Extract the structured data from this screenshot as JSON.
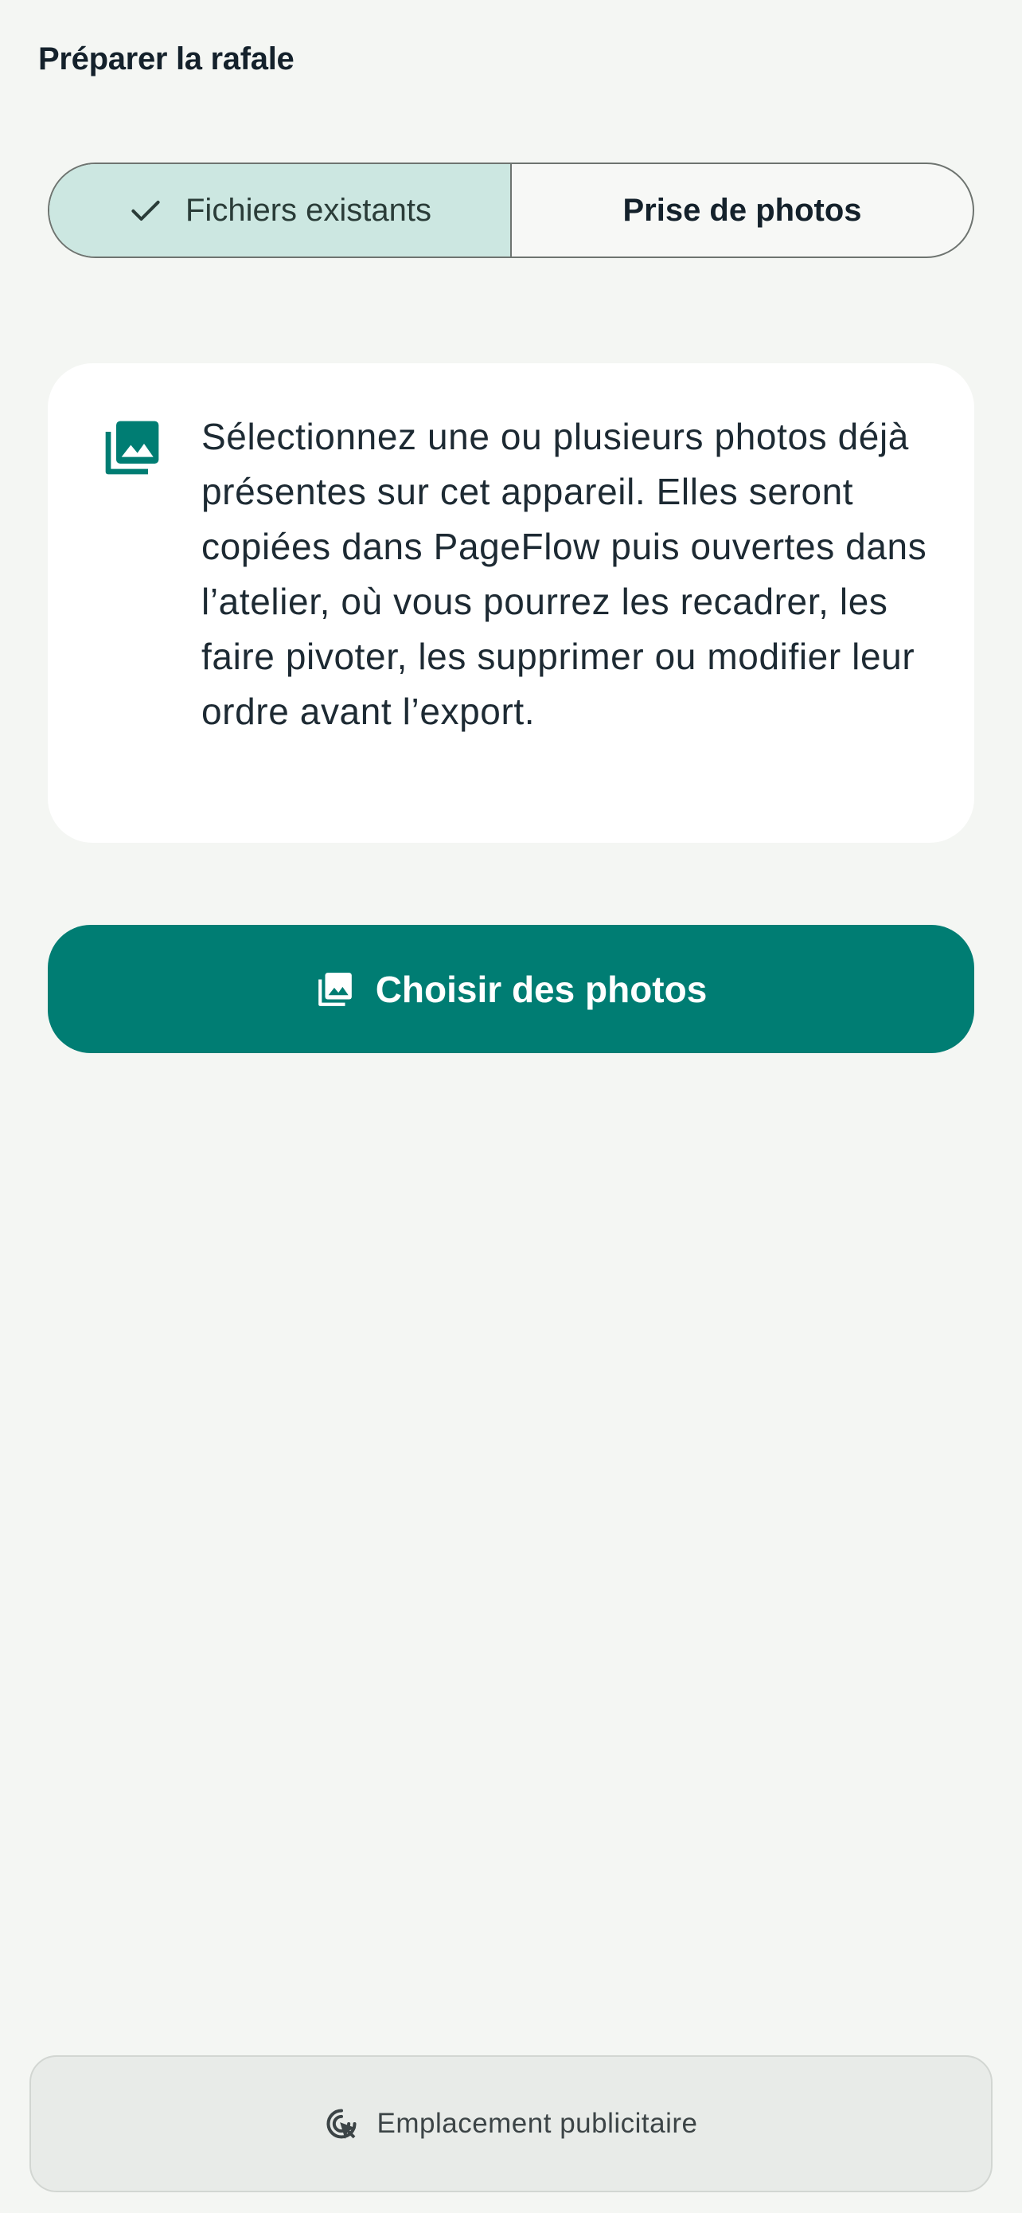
{
  "page": {
    "title": "Préparer la rafale"
  },
  "mode_selector": {
    "options": [
      {
        "label": "Fichiers existants",
        "selected": true
      },
      {
        "label": "Prise de photos",
        "selected": false
      }
    ]
  },
  "info_card": {
    "icon": "photo-library-icon",
    "text": "Sélectionnez une ou plusieurs photos déjà présentes sur cet appareil. Elles seront copiées dans PageFlow puis ouvertes dans l’atelier, où vous pourrez les recadrer, les faire pivoter, les supprimer ou modifier leur ordre avant l’export."
  },
  "primary_action": {
    "icon": "photo-library-icon",
    "label": "Choisir des photos"
  },
  "ad": {
    "icon": "ad-click-icon",
    "label": "Emplacement publicitaire"
  },
  "colors": {
    "accent": "#007d73",
    "selected_segment": "#cce7e1",
    "background": "#f4f6f3"
  }
}
